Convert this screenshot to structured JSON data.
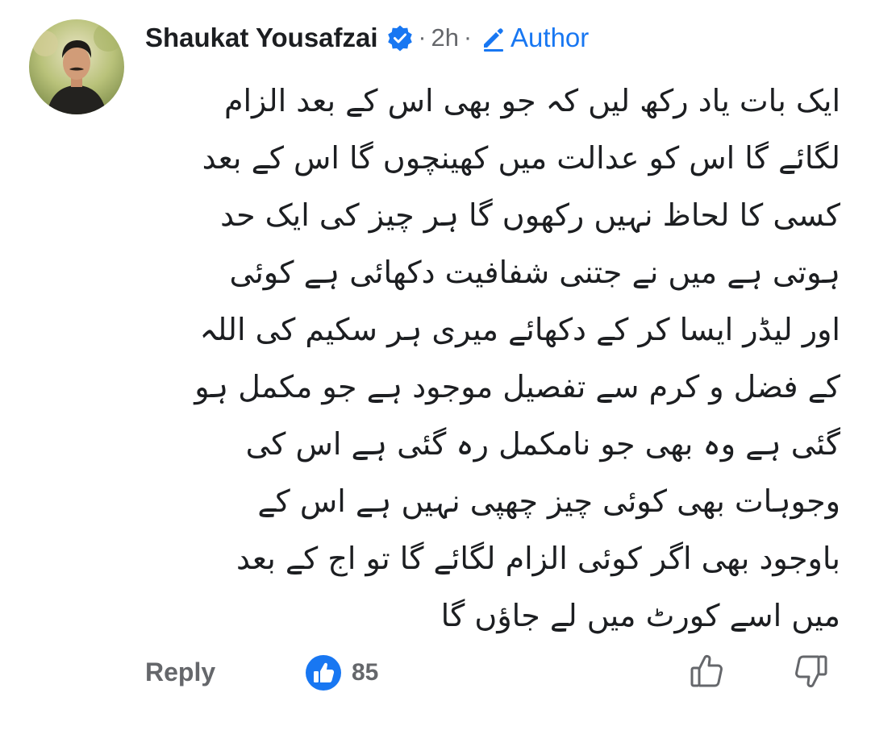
{
  "comment": {
    "author": "Shaukat Yousafzai",
    "separator": "·",
    "time": "2h",
    "author_badge": "Author",
    "lines": [
      "ایک بات یاد رکھ لیں کہ جو بھی اس کے بعد الزام",
      "لگائے گا اس کو عدالت میں کھینچوں گا اس کے بعد",
      "کسی کا لحاظ نہیں رکھوں گا ہر چیز کی ایک حد",
      "ہوتی ہے میں نے جتنی شفافیت دکھائی ہے کوئی",
      "اور لیڈر ایسا کر کے دکھائے میری ہر سکیم کی اللہ",
      "کے فضل و کرم سے تفصیل موجود ہے جو مکمل ہو",
      "گئی ہے وہ بھی جو نامکمل رہ گئی ہے اس کی",
      "وجوہات بھی کوئی چیز چھپی نہیں ہے اس کے",
      "باوجود بھی اگر کوئی الزام لگائے گا تو اج کے بعد",
      "میں اسے کورٹ میں لے جاؤں گا"
    ]
  },
  "actions": {
    "reply_label": "Reply",
    "like_count": "85"
  },
  "icons": {
    "verified": "verified-badge-icon",
    "author": "pencil-icon",
    "like": "like-reaction-icon",
    "upvote": "thumbs-up-outline-icon",
    "downvote": "thumbs-down-outline-icon"
  },
  "colors": {
    "brand_blue": "#1877f2",
    "secondary_text": "#65676b",
    "primary_text": "#1c1e21"
  }
}
